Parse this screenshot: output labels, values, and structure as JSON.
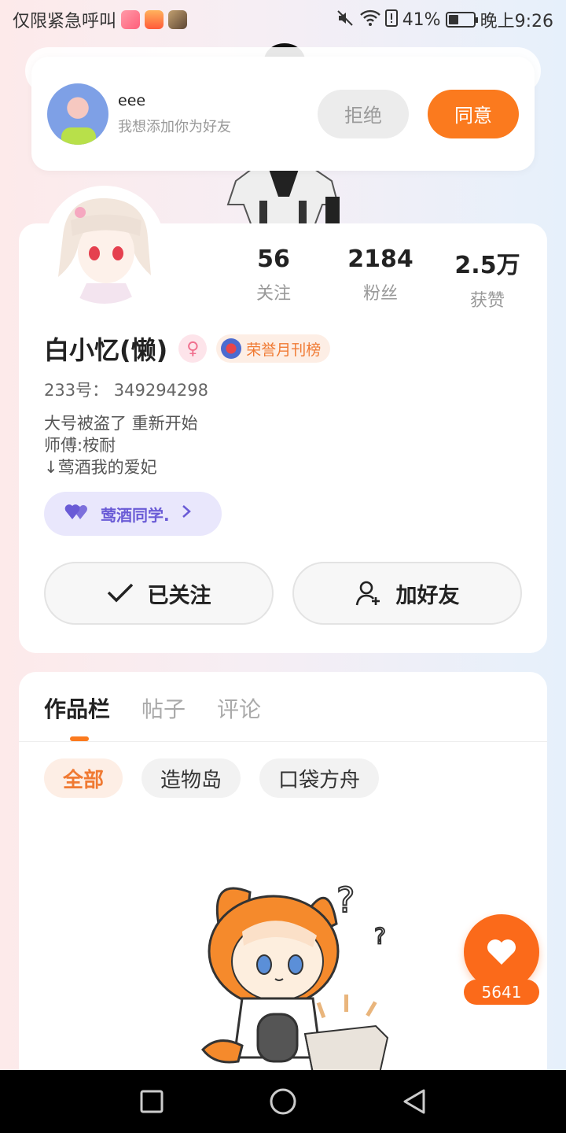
{
  "status_bar": {
    "carrier": "仅限紧急呼叫",
    "battery": "41%",
    "battery_level": 0.41,
    "time": "晚上9:26"
  },
  "friend_request": {
    "name": "eee",
    "message": "我想添加你为好友",
    "reject_label": "拒绝",
    "accept_label": "同意"
  },
  "profile": {
    "stats": [
      {
        "value": "56",
        "label": "关注"
      },
      {
        "value": "2184",
        "label": "粉丝"
      },
      {
        "value": "2.5万",
        "label": "获赞"
      }
    ],
    "name": "白小忆(懒)",
    "gender_symbol": "♀",
    "honor_badge": "荣誉月刊榜",
    "uid": "233号： 349294298",
    "bio": [
      "大号被盗了  重新开始",
      "师傅:桉耐",
      "↓莺酒我的爱妃"
    ],
    "cp_tag": "莺酒同学.",
    "follow_label": "已关注",
    "add_friend_label": "加好友"
  },
  "works": {
    "tabs": [
      "作品栏",
      "帖子",
      "评论"
    ],
    "filters": [
      "全部",
      "造物岛",
      "口袋方舟"
    ]
  },
  "like": {
    "count": "5641"
  },
  "colors": {
    "accent": "#fb7a1e",
    "cp_purple": "#6a5bd6"
  }
}
